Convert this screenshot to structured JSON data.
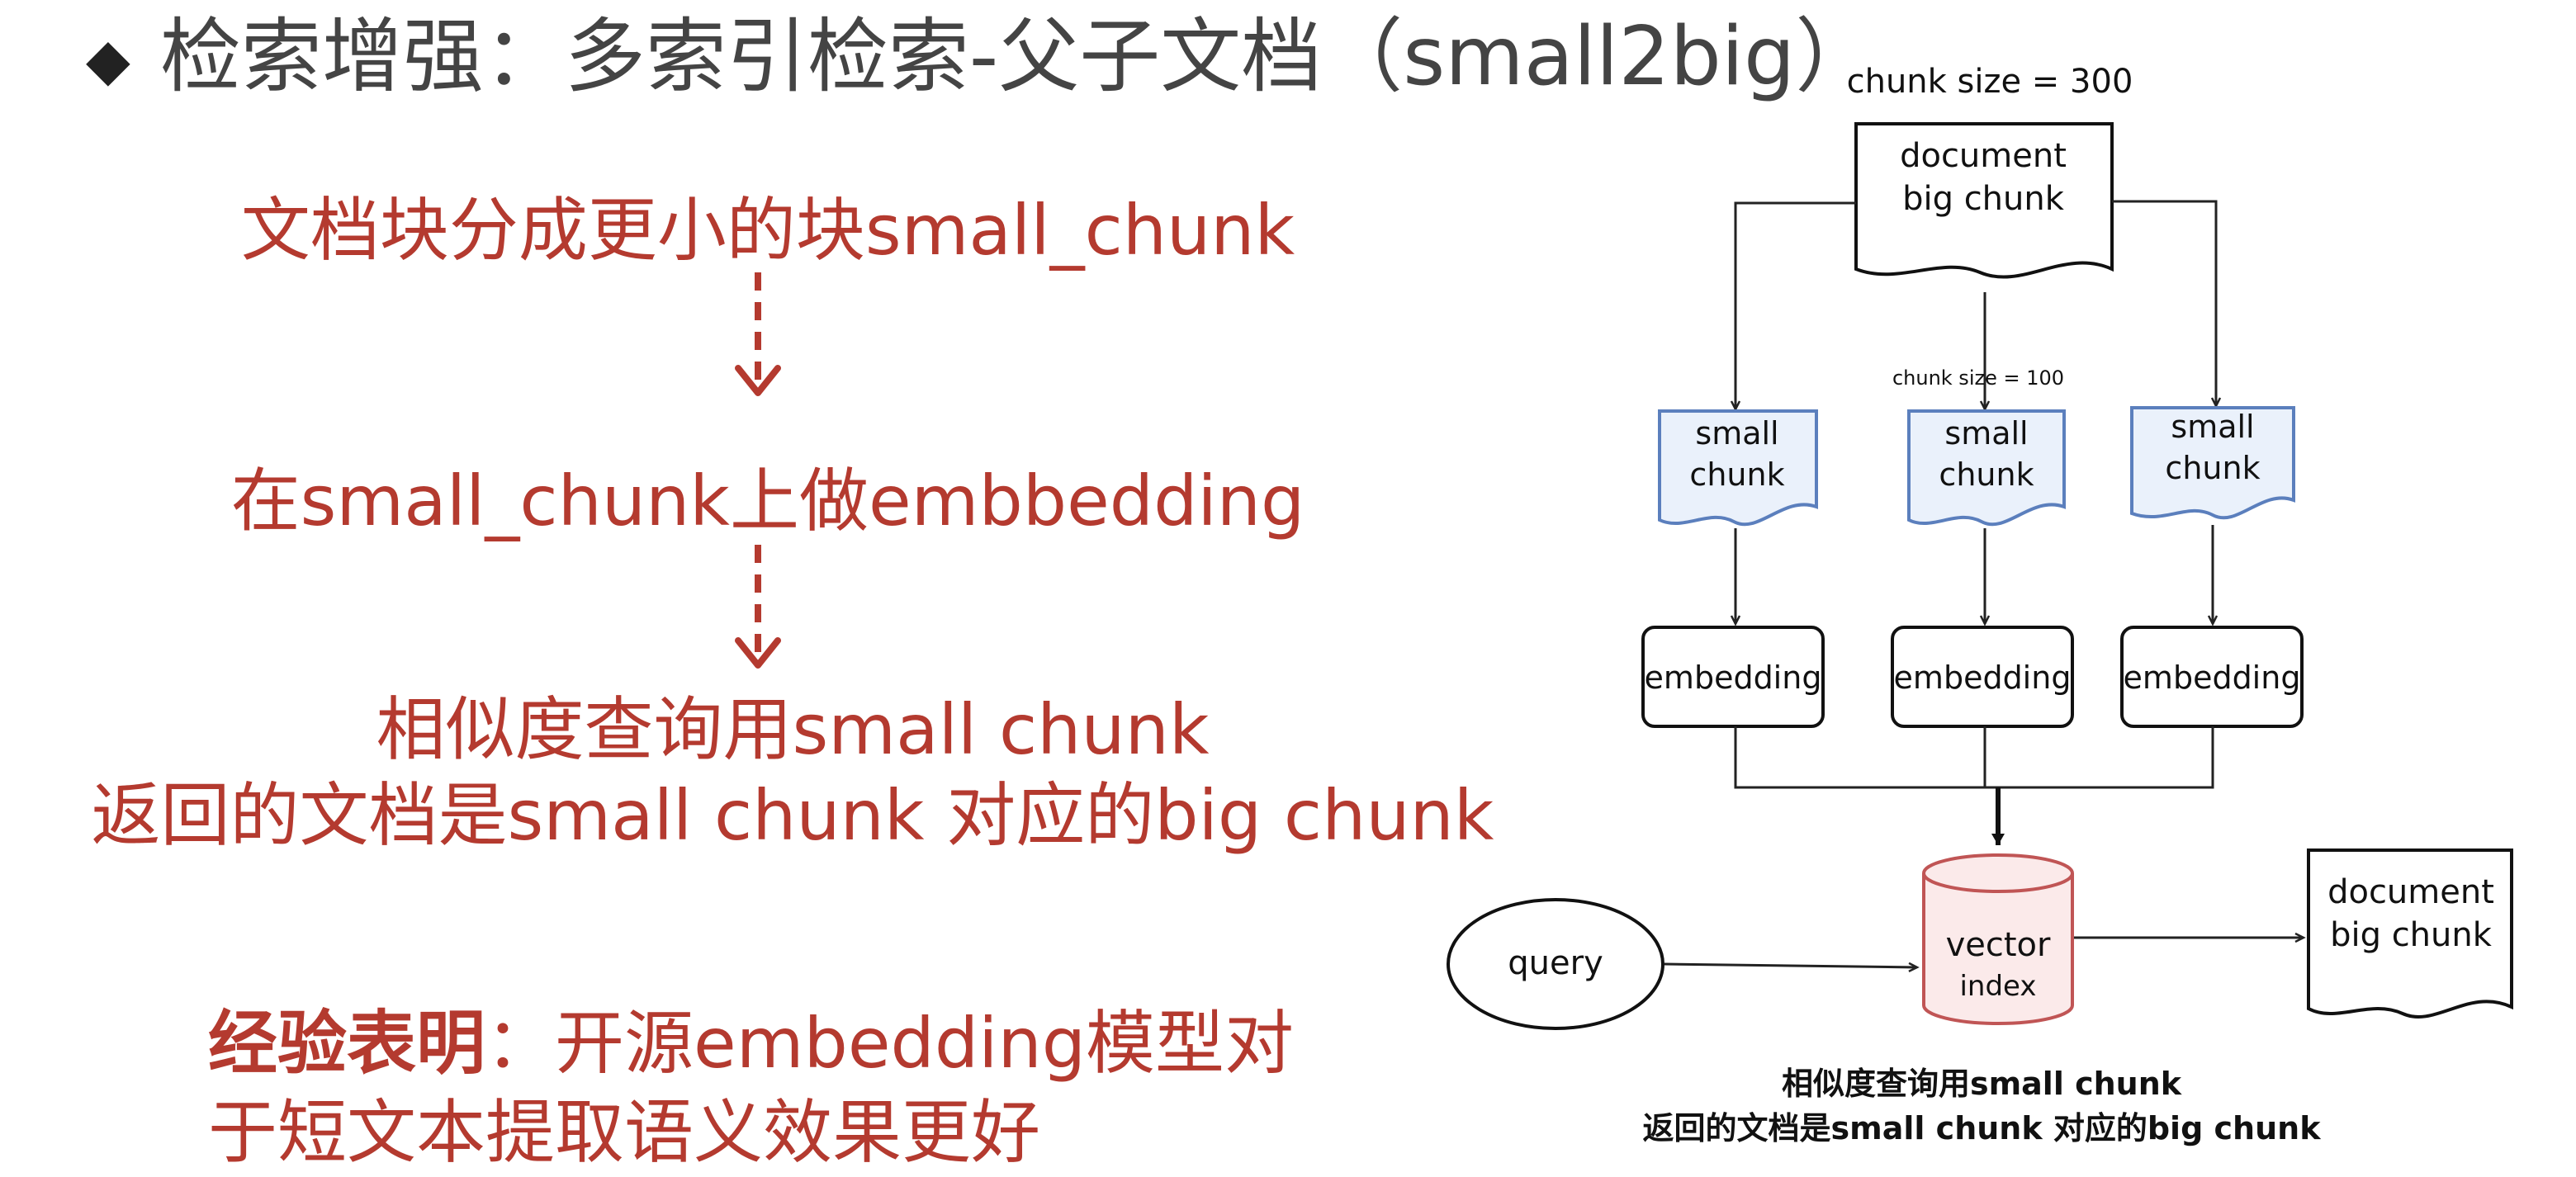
{
  "slide": {
    "bullet": "◆",
    "title": "检索增强：多索引检索-父子文档（small2big）",
    "steps": [
      "文档块分成更小的块small_chunk",
      "在small_chunk上做embbedding",
      "相似度查询用small chunk",
      "返回的文档是small chunk 对应的big chunk"
    ],
    "note_bold": "经验表明",
    "note_line1": "：开源embedding模型对",
    "note_line2": "于短文本提取语义效果更好"
  },
  "diagram": {
    "chunk_size_top": "chunk size = 300",
    "big_doc_line1": "document",
    "big_doc_line2": "big chunk",
    "chunk_size_mid": "chunk size = 100",
    "small_line1": "small",
    "small_line2": "chunk",
    "embedding": "embedding",
    "query": "query",
    "vector_line1": "vector",
    "vector_line2": "index",
    "result_doc_line1": "document",
    "result_doc_line2": "big chunk",
    "caption_line1": "相似度查询用small chunk",
    "caption_line2": "返回的文档是small chunk 对应的big chunk"
  }
}
